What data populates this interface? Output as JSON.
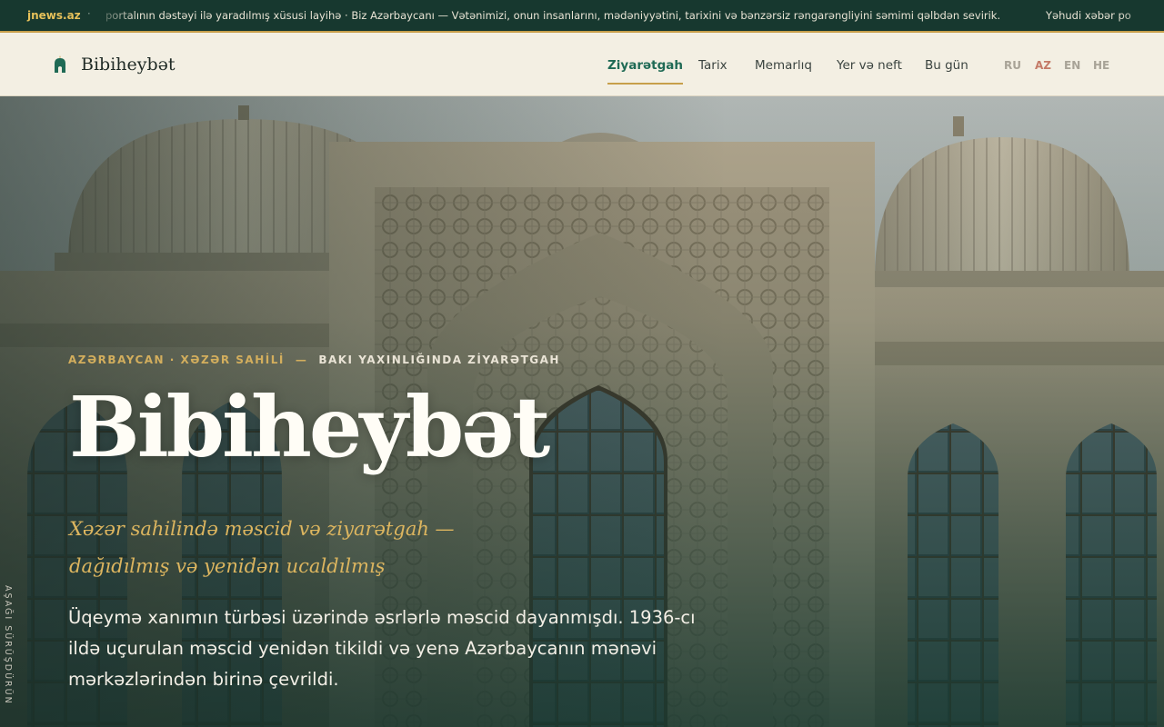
{
  "ticker": {
    "brand": "jnews.az",
    "separator": "·",
    "message": "portalının dəstəyi ilə yaradılmış xüsusi layihə · Biz Azərbaycanı — Vətənimizi, onun insanlarını, mədəniyyətini, tarixini və bənzərsiz rəngarəngliyini səmimi qəlbdən sevirik.",
    "message_next": "Yəhudi xəbər po"
  },
  "header": {
    "logo_text": "Bibiheybət",
    "nav": [
      {
        "label": "Ziyarətgah",
        "active": true
      },
      {
        "label": "Tarix",
        "active": false
      },
      {
        "label": "Memarlıq",
        "active": false
      },
      {
        "label": "Yer və neft",
        "active": false
      },
      {
        "label": "Bu gün",
        "active": false
      }
    ],
    "languages": [
      {
        "code": "RU",
        "active": false
      },
      {
        "code": "AZ",
        "active": true
      },
      {
        "code": "EN",
        "active": false
      },
      {
        "code": "HE",
        "active": false
      }
    ]
  },
  "hero": {
    "eyebrow_location": "AZƏRBAYCAN · XƏZƏR SAHİLİ",
    "eyebrow_dash": "—",
    "eyebrow_kind": "BAKI YAXINLIĞINDA ZİYARƏTGAH",
    "title": "Bibiheybət",
    "subtitle_line1": "Xəzər sahilində məscid və ziyarətgah —",
    "subtitle_line2": "dağıdılmış və yenidən ucaldılmış",
    "lede": "Üqeymə xanımın türbəsi üzərində əsrlərlə məscid dayanmışdı. 1936-cı ildə uçurulan məscid yenidən tikildi və yenə Azərbaycanın mənəvi mərkəzlərindən birinə çevrildi.",
    "scroll_hint": "AŞAĞI SÜRÜŞDÜRÜN"
  },
  "colors": {
    "ticker_bg": "#17382f",
    "accent_gold": "#c79f4a",
    "header_bg": "#f3efe3",
    "nav_active": "#1f6a55",
    "lang_active": "#c47a67"
  }
}
